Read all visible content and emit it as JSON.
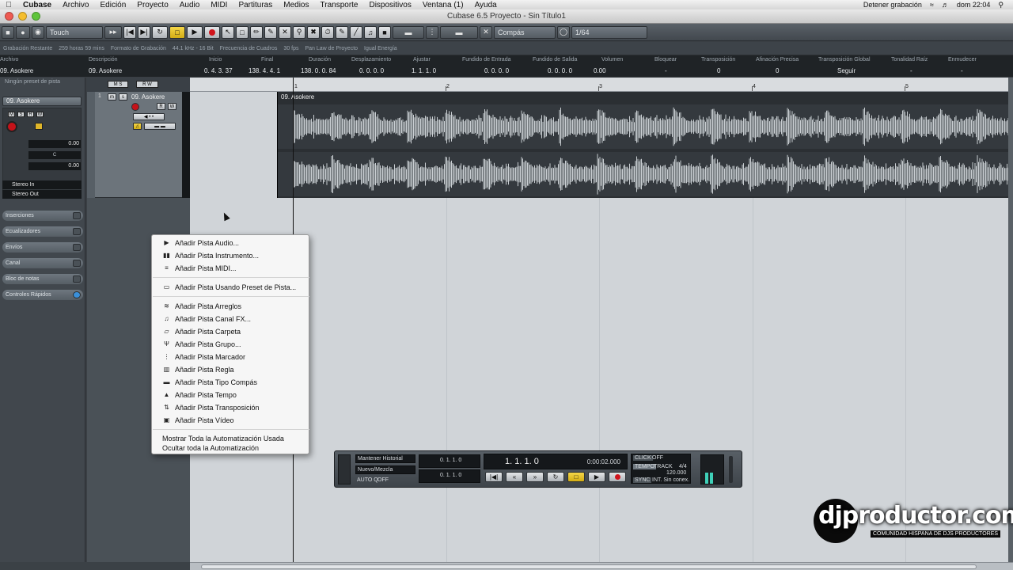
{
  "menubar": {
    "items": [
      "Cubase",
      "Archivo",
      "Edición",
      "Proyecto",
      "Audio",
      "MIDI",
      "Partituras",
      "Medios",
      "Transporte",
      "Dispositivos",
      "Ventana (1)",
      "Ayuda"
    ],
    "status_text": "Detener grabación",
    "clock": "dom 22:04"
  },
  "window": {
    "title": "Cubase 6.5 Proyecto - Sin Título1"
  },
  "toolbar": {
    "mode": "Touch",
    "grid_type": "Compás",
    "quantize": "1/64"
  },
  "infoline": {
    "items": [
      "Grabación Restante",
      "259 horas 59 mins",
      "Formato de Grabación",
      "44.1 kHz - 16 Bit",
      "Frecuencia de Cuadros",
      "30 fps",
      "Pan Law de Proyecto",
      "Igual Energía"
    ]
  },
  "infotable": {
    "headers": [
      "Archivo",
      "Descripción",
      "Inicio",
      "Final",
      "Duración",
      "Desplazamiento",
      "Ajustar",
      "Fundido de Entrada",
      "Fundido de Salida",
      "Volumen",
      "Bloquear",
      "Transposición",
      "Afinación Precisa",
      "Transposición Global",
      "Tonalidad Raíz",
      "Enmudecer"
    ],
    "values": [
      "09. Asokere",
      "09. Asokere",
      "0. 4. 3. 37",
      "138. 4. 4. 1",
      "138. 0. 0. 84",
      "0. 0. 0. 0",
      "1. 1. 1. 0",
      "0. 0. 0. 0",
      "0. 0. 0. 0",
      "0.00",
      "-",
      "0",
      "0",
      "Seguir",
      "-",
      "-"
    ]
  },
  "inspector": {
    "preset": "Ningún preset de pista",
    "channel_name": "09. Asokere",
    "volume": "0.00",
    "pan": "C",
    "pan_value": "0.00",
    "input": "Stereo In",
    "output": "Stereo Out",
    "sections": [
      "Inserciones",
      "Ecualizadores",
      "Envíos",
      "Canal",
      "Bloc de notas",
      "Controles Rápidos"
    ]
  },
  "track": {
    "number": "1",
    "name": "09. Asokere",
    "event_name": "09. Asokere"
  },
  "ruler": {
    "bars": [
      "1",
      "2",
      "3",
      "4",
      "5"
    ]
  },
  "context_menu": {
    "items": [
      {
        "icon": "▶",
        "label": "Añadir Pista Audio..."
      },
      {
        "icon": "▮▮",
        "label": "Añadir Pista Instrumento..."
      },
      {
        "icon": "≡",
        "label": "Añadir Pista MIDI..."
      },
      {
        "icon": "▭",
        "label": "Añadir Pista Usando Preset de Pista..."
      },
      {
        "icon": "≋",
        "label": "Añadir Pista Arreglos"
      },
      {
        "icon": "♫",
        "label": "Añadir Pista Canal FX..."
      },
      {
        "icon": "▱",
        "label": "Añadir Pista Carpeta"
      },
      {
        "icon": "Ψ",
        "label": "Añadir Pista Grupo..."
      },
      {
        "icon": "⋮",
        "label": "Añadir Pista Marcador"
      },
      {
        "icon": "▥",
        "label": "Añadir Pista Regla"
      },
      {
        "icon": "▬",
        "label": "Añadir Pista Tipo Compás"
      },
      {
        "icon": "▲",
        "label": "Añadir Pista Tempo"
      },
      {
        "icon": "⇅",
        "label": "Añadir Pista Transposición"
      },
      {
        "icon": "▣",
        "label": "Añadir Pista Vídeo"
      }
    ],
    "footer": [
      "Mostrar Toda la Automatización Usada",
      "Ocultar toda la Automatización"
    ]
  },
  "transport": {
    "history": "Mantener Historial",
    "mix": "Nuevo/Mezcla",
    "auto_q": "AUTO Q",
    "auto_q_state": "OFF",
    "left_locator": "0. 1. 1. 0",
    "right_locator": "0. 1. 1. 0",
    "position": "1. 1. 1. 0",
    "time": "0:00:02.000",
    "click": "CLICK",
    "click_state": "OFF",
    "tempo": "TEMPO",
    "tempo_mode": "TRACK",
    "signature": "4/4",
    "bpm": "120.000",
    "sync": "SYNC",
    "sync_state": "INT. Sin conex."
  },
  "watermark": {
    "brand": "djproductor.com",
    "tagline": "COMUNIDAD HISPANA DE DJS PRODUCTORES"
  },
  "colors": {
    "accent_yellow": "#d9b31a",
    "record_red": "#d0141c",
    "waveform": "#c9ced2"
  }
}
